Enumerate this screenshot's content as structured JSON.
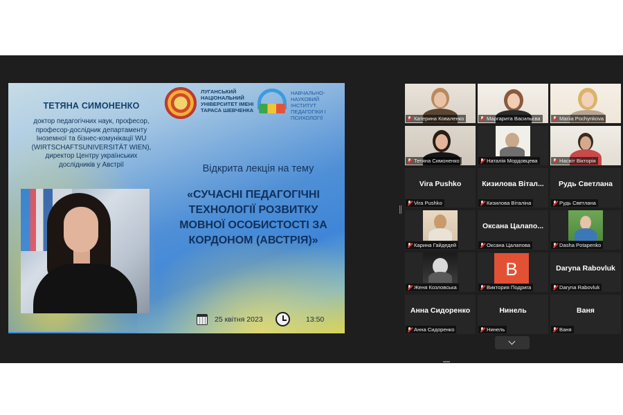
{
  "slide": {
    "speaker_name": "ТЕТЯНА СИМОНЕНКО",
    "speaker_bio": "доктор педагогічних наук, професор,\nпрофесор-дослідник департаменту\nІноземної та бізнес-комунікації WU\n(WIRTSCHAFTSUNIVERSITÄT WIEN),\nдиректор Центру українських\nдослідників у Австрії",
    "logo1_text": "ЛУГАНСЬКИЙ\nНАЦІОНАЛЬНИЙ\nУНІВЕРСИТЕТ ІМЕНІ\nТАРАСА ШЕВЧЕНКА",
    "logo2_text": "НАВЧАЛЬНО-\nНАУКОВИЙ ІНСТИТУТ\nПЕДАГОГІКИ І\nПСИХОЛОГІЇ",
    "lecture_label": "Відкрита лекція на тему",
    "lecture_title": "«СУЧАСНІ ПЕДАГОГІЧНІ\nТЕХНОЛОГІЇ РОЗВИТКУ\nМОВНОЇ ОСОБИСТОСТІ ЗА\nКОРДОНОМ (АВСТРІЯ)»",
    "date": "25 квітня 2023",
    "time": "13:50"
  },
  "participants": [
    {
      "name": "Катерина Коваленко",
      "display": "",
      "video": true
    },
    {
      "name": "Маргарита Васильєва",
      "display": "",
      "video": true
    },
    {
      "name": "Mariia Pochynkova",
      "display": "",
      "video": true
    },
    {
      "name": "Тетяна Симоненко",
      "display": "",
      "video": true,
      "active": true
    },
    {
      "name": "Наталія Мордовцева",
      "display": "",
      "video": true
    },
    {
      "name": "Насвіт Вікторія",
      "display": "",
      "video": true
    },
    {
      "name": "Vira Pushko",
      "display": "Vira Pushko",
      "video": false
    },
    {
      "name": "Кизилова Віталіна",
      "display": "Кизилова Вітал...",
      "video": false
    },
    {
      "name": "Рудь Светлана",
      "display": "Рудь Светлана",
      "video": false
    },
    {
      "name": "Карина Гайдедей",
      "display": "",
      "video": "thumb"
    },
    {
      "name": "Оксана Цалапова",
      "display": "Оксана Цалапо...",
      "video": false
    },
    {
      "name": "Dasha Potapenko",
      "display": "",
      "video": "thumb"
    },
    {
      "name": "Женя Козловська",
      "display": "",
      "video": "thumb"
    },
    {
      "name": "Виктория Подрига",
      "display": "",
      "video": "avatar",
      "avatar_letter": "B",
      "avatar_color": "#e35134"
    },
    {
      "name": "Daryna Rabovluk",
      "display": "Daryna Rabovluk",
      "video": false
    },
    {
      "name": "Анна Сидоренко",
      "display": "Анна Сидоренко",
      "video": false
    },
    {
      "name": "Нинель",
      "display": "Нинель",
      "video": false
    },
    {
      "name": "Ваня",
      "display": "Ваня",
      "video": false
    }
  ],
  "colors": {
    "active_speaker_border": "#b9d425",
    "muted_mic": "#e33333",
    "tile_background": "#262626"
  },
  "icons": {
    "calendar": "calendar-icon",
    "clock": "clock-icon",
    "muted": "mic-muted-icon",
    "scroll": "chevron-down-icon"
  }
}
